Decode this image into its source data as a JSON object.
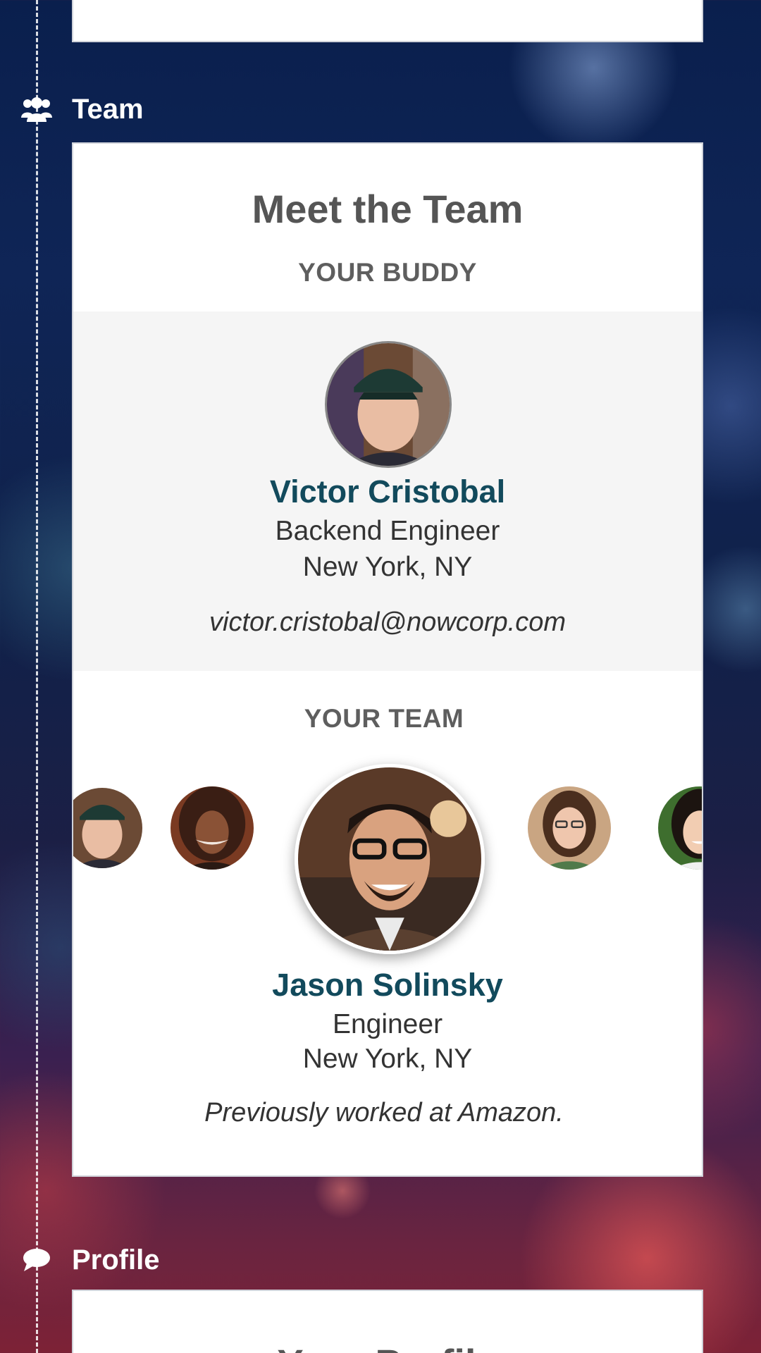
{
  "sections": {
    "team": {
      "label": "Team",
      "icon": "team-icon"
    },
    "profile": {
      "label": "Profile",
      "icon": "speech-bubble-icon"
    }
  },
  "team_card": {
    "title": "Meet the Team",
    "buddy_heading": "YOUR BUDDY",
    "buddy": {
      "name": "Victor Cristobal",
      "role": "Backend Engineer",
      "location": "New York, NY",
      "email": "victor.cristobal@nowcorp.com"
    },
    "team_heading": "YOUR TEAM",
    "carousel": {
      "selected": {
        "name": "Jason Solinsky",
        "role": "Engineer",
        "location": "New York, NY",
        "bio": "Previously worked at Amazon."
      }
    }
  },
  "profile_card": {
    "title": "Your Profile"
  },
  "colors": {
    "name_color": "#124a5c",
    "band_color": "#f5f5f5"
  }
}
